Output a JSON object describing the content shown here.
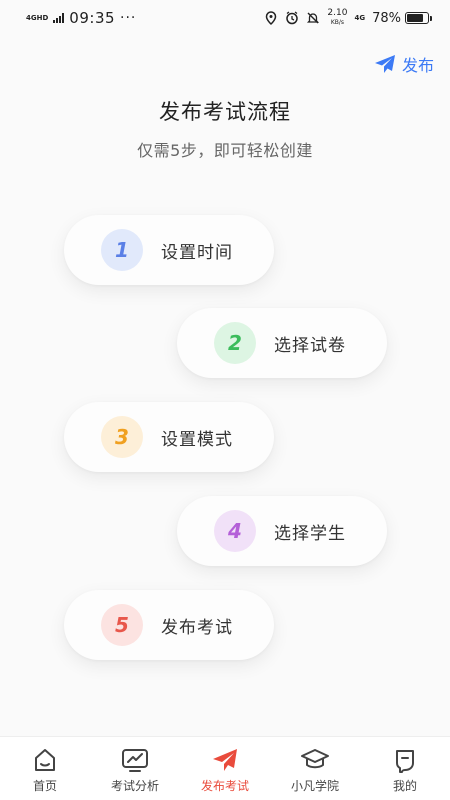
{
  "status_bar": {
    "network": "4GHD",
    "time": "09:35",
    "more": "···",
    "speed_value": "2.10",
    "speed_unit": "KB/s",
    "network2": "4G",
    "battery": "78%",
    "battery_level": 0.78
  },
  "header": {
    "publish_label": "发布"
  },
  "page": {
    "title": "发布考试流程",
    "subtitle": "仅需5步，即可轻松创建"
  },
  "steps": [
    {
      "number": "1",
      "label": "设置时间",
      "badge_bg": "#e1e9fb",
      "badge_color": "#5a7fe6"
    },
    {
      "number": "2",
      "label": "选择试卷",
      "badge_bg": "#ddf5e3",
      "badge_color": "#3cbc5c"
    },
    {
      "number": "3",
      "label": "设置模式",
      "badge_bg": "#fdefd8",
      "badge_color": "#f0a020"
    },
    {
      "number": "4",
      "label": "选择学生",
      "badge_bg": "#f1e1f8",
      "badge_color": "#b45fd8"
    },
    {
      "number": "5",
      "label": "发布考试",
      "badge_bg": "#fce3e1",
      "badge_color": "#e8574b"
    }
  ],
  "bottom_nav": {
    "items": [
      {
        "label": "首页",
        "icon": "home-icon"
      },
      {
        "label": "考试分析",
        "icon": "chart-monitor-icon"
      },
      {
        "label": "发布考试",
        "icon": "paper-plane-icon",
        "active": true
      },
      {
        "label": "小凡学院",
        "icon": "graduation-cap-icon"
      },
      {
        "label": "我的",
        "icon": "user-face-icon"
      }
    ]
  },
  "colors": {
    "accent_blue": "#3c7af5",
    "active_red": "#e94b3c"
  }
}
